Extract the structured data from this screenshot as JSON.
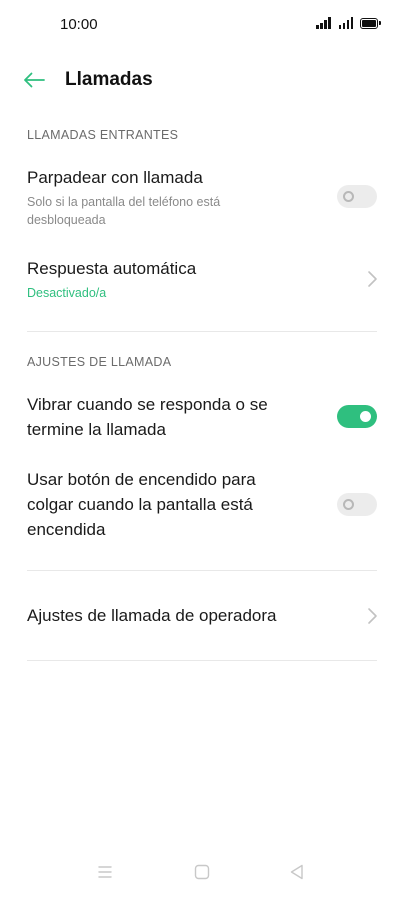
{
  "status_bar": {
    "time": "10:00",
    "icons": [
      "signal-icon",
      "signal-icon",
      "battery-icon"
    ]
  },
  "app_bar": {
    "title": "Llamadas",
    "back_icon": "arrow-left-icon"
  },
  "colors": {
    "accent": "#2fbf7f",
    "toggle_off": "#ececec",
    "text_primary": "#1a1a1a",
    "text_secondary": "#8a8a8a"
  },
  "sections": [
    {
      "header": "LLAMADAS ENTRANTES",
      "items": [
        {
          "title": "Parpadear con llamada",
          "subtitle_line1": "Solo si la pantalla del teléfono está",
          "subtitle_line2": "desbloqueada",
          "control": "toggle",
          "enabled": false
        },
        {
          "title": "Respuesta automática",
          "subtitle": "Desactivado/a",
          "control": "chevron"
        }
      ]
    },
    {
      "header": "AJUSTES DE LLAMADA",
      "items": [
        {
          "title_line1": "Vibrar cuando se responda o se",
          "title_line2": "termine la llamada",
          "control": "toggle",
          "enabled": true
        },
        {
          "title_line1": "Usar botón de encendido para",
          "title_line2": "colgar cuando la pantalla está",
          "title_line3": "encendida",
          "control": "toggle",
          "enabled": false
        }
      ]
    },
    {
      "items": [
        {
          "title": "Ajustes de llamada de operadora",
          "control": "chevron"
        }
      ]
    }
  ],
  "nav_bar": {
    "icons": [
      "menu-icon",
      "home-icon",
      "back-icon"
    ]
  }
}
